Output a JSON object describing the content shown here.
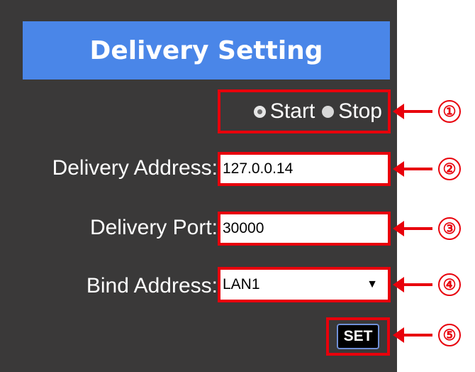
{
  "header": {
    "title": "Delivery Setting"
  },
  "delivery_state": {
    "options": [
      {
        "label": "Start",
        "selected": true
      },
      {
        "label": "Stop",
        "selected": false
      }
    ]
  },
  "delivery_address": {
    "label": "Delivery Address:",
    "value": "127.0.0.14"
  },
  "delivery_port": {
    "label": "Delivery Port:",
    "value": "30000"
  },
  "bind_address": {
    "label": "Bind Address:",
    "selected": "LAN1",
    "arrow_glyph": "▼"
  },
  "set_button": {
    "label": "SET"
  },
  "callouts": [
    "①",
    "②",
    "③",
    "④",
    "⑤"
  ],
  "colors": {
    "panel": "#3a3939",
    "header": "#4a86e8",
    "highlight": "#e8000b"
  }
}
